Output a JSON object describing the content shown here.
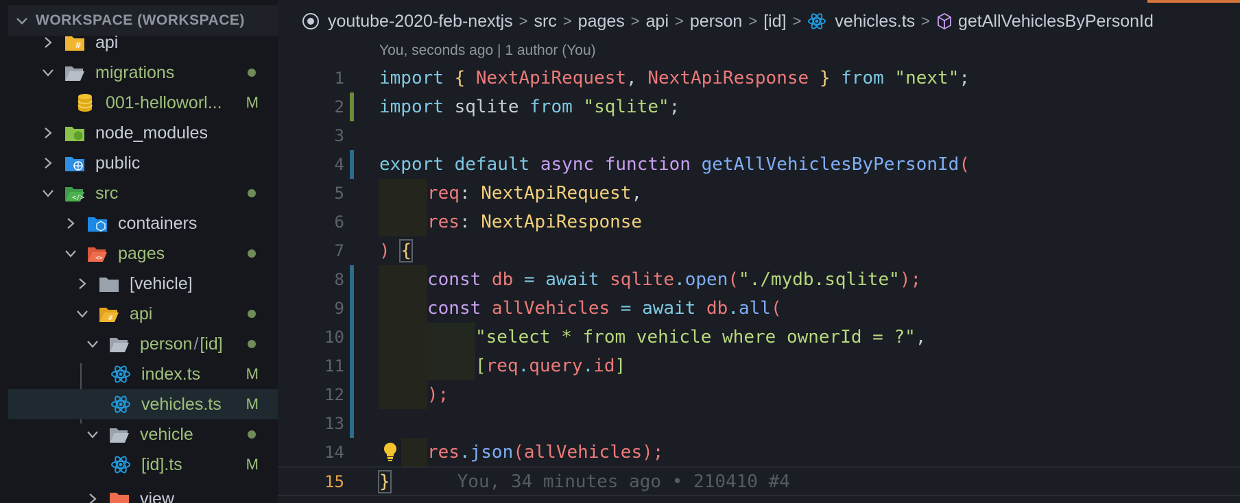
{
  "sidebar": {
    "workspace_title": "WORKSPACE (WORKSPACE)",
    "items": [
      {
        "label": "api",
        "status": ""
      },
      {
        "label": "migrations",
        "status": "dot"
      },
      {
        "label": "001-helloworl...",
        "status": "M"
      },
      {
        "label": "node_modules",
        "status": ""
      },
      {
        "label": "public",
        "status": ""
      },
      {
        "label": "src",
        "status": "dot"
      },
      {
        "label": "containers",
        "status": ""
      },
      {
        "label": "pages",
        "status": "dot"
      },
      {
        "label": "[vehicle]",
        "status": ""
      },
      {
        "label": "api",
        "status": "dot"
      },
      {
        "label": "person",
        "label2": "[id]",
        "sep": "/",
        "status": "dot"
      },
      {
        "label": "index.ts",
        "status": "M"
      },
      {
        "label": "vehicles.ts",
        "status": "M"
      },
      {
        "label": "vehicle",
        "status": "dot"
      },
      {
        "label": "[id].ts",
        "status": "M"
      },
      {
        "label": "view",
        "status": ""
      }
    ]
  },
  "breadcrumb": [
    "youtube-2020-feb-nextjs",
    "src",
    "pages",
    "api",
    "person",
    "[id]",
    "vehicles.ts",
    "getAllVehiclesByPersonId"
  ],
  "editor": {
    "blame_header": "You, seconds ago | 1 author (You)",
    "line_numbers": [
      "1",
      "2",
      "3",
      "4",
      "5",
      "6",
      "7",
      "8",
      "9",
      "10",
      "11",
      "12",
      "13",
      "14",
      "15"
    ],
    "code": {
      "l1": [
        "import",
        " ",
        "{",
        " ",
        "NextApiRequest",
        ", ",
        "NextApiResponse",
        " ",
        "}",
        " ",
        "from",
        " ",
        "\"next\"",
        ";"
      ],
      "l2": [
        "import",
        " sqlite ",
        "from",
        " ",
        "\"sqlite\"",
        ";"
      ],
      "l4": [
        "export",
        " ",
        "default",
        " ",
        "async",
        " ",
        "function",
        " ",
        "getAllVehiclesByPersonId",
        "("
      ],
      "l5": [
        "req",
        ": ",
        "NextApiRequest",
        ","
      ],
      "l6": [
        "res",
        ": ",
        "NextApiResponse"
      ],
      "l7": [
        ")",
        " ",
        "{"
      ],
      "l8": [
        "const",
        " ",
        "db",
        " ",
        "=",
        " ",
        "await",
        " ",
        "sqlite",
        ".",
        "open",
        "(",
        "\"./mydb.sqlite\"",
        ");"
      ],
      "l9": [
        "const",
        " ",
        "allVehicles",
        " ",
        "=",
        " ",
        "await",
        " ",
        "db",
        ".",
        "all",
        "("
      ],
      "l10": [
        "\"select * from vehicle where ownerId = ?\"",
        ","
      ],
      "l11": [
        "[",
        "req",
        ".",
        "query",
        ".",
        "id",
        "]"
      ],
      "l12": [
        ");"
      ],
      "l14": [
        "res",
        ".",
        "json",
        "(",
        "allVehicles",
        ");"
      ],
      "l15": [
        "}"
      ]
    },
    "inline_blame": "You, 34 minutes ago • 210410 #4"
  },
  "colors": {
    "sidebar_bg": "#15171c",
    "editor_bg": "#1a1d23",
    "added_gutter": "#6b8c3a",
    "modified_gutter": "#2c6d8a",
    "tab_accent": "#d5743b"
  }
}
